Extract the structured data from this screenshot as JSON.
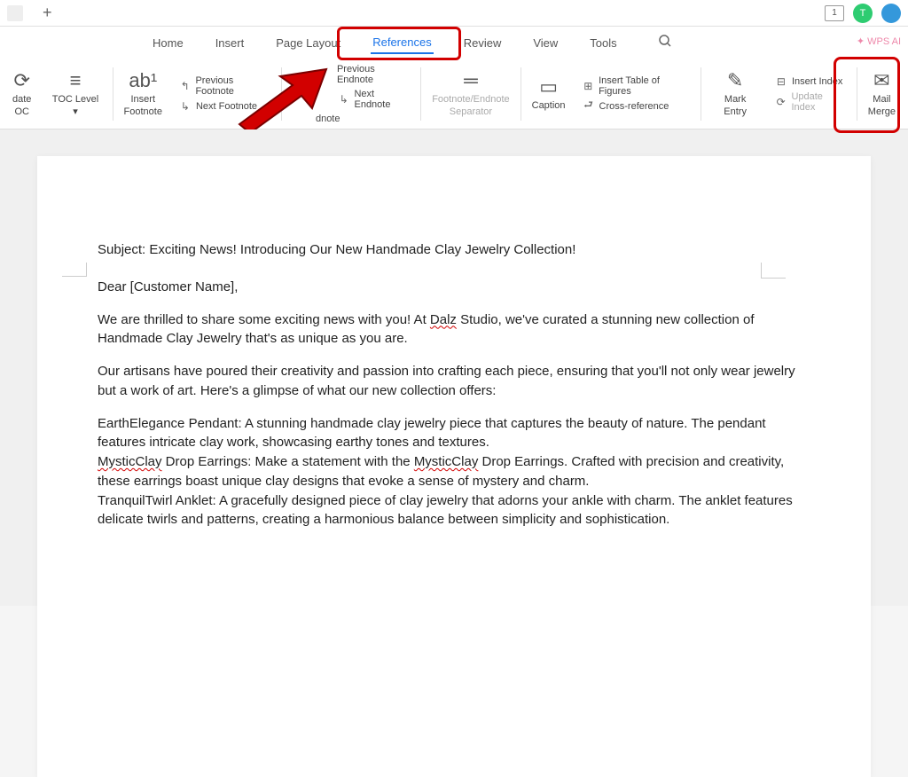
{
  "titlebar": {
    "plus": "+",
    "badge": "1",
    "user": "T"
  },
  "menu": {
    "home": "Home",
    "insert": "Insert",
    "page_layout": "Page Layout",
    "references": "References",
    "review": "Review",
    "view": "View",
    "tools": "Tools"
  },
  "wps_ai": "✦ WPS AI",
  "ribbon": {
    "date_oc": "date\nOC",
    "toc_level": "TOC Level ▾",
    "insert_footnote": "Insert\nFootnote",
    "prev_footnote": "Previous Footnote",
    "next_footnote": "Next Footnote",
    "dnote": "dnote",
    "prev_endnote": "Previous Endnote",
    "next_endnote": "Next Endnote",
    "footnote_separator": "Footnote/Endnote\nSeparator",
    "caption": "Caption",
    "insert_tof": "Insert Table of Figures",
    "cross_ref": "Cross-reference",
    "mark_entry": "Mark Entry",
    "insert_index": "Insert Index",
    "update_index": "Update Index",
    "mail_merge": "Mail\nMerge"
  },
  "document": {
    "subject": "Subject: Exciting News! Introducing Our New Handmade Clay Jewelry Collection!",
    "greeting": "Dear [Customer Name],",
    "para1_a": "We are thrilled to share some exciting news with you! At ",
    "para1_dalz": "Dalz",
    "para1_b": " Studio, we've curated a stunning new collection of Handmade Clay Jewelry that's as unique as you are.",
    "para2": "Our artisans have poured their creativity and passion into crafting each piece, ensuring that you'll not only wear jewelry but a work of art. Here's a glimpse of what our new collection offers:",
    "para3_a": "EarthElegance Pendant: A stunning handmade clay jewelry piece that captures the beauty of nature. The pendant features intricate clay work, showcasing earthy tones and textures.",
    "para3_mystic1": "MysticClay",
    "para3_b": " Drop Earrings: Make a statement with the ",
    "para3_mystic2": "MysticClay",
    "para3_c": " Drop Earrings. Crafted with precision and creativity, these earrings boast unique clay designs that evoke a sense of mystery and charm.",
    "para3_d": "TranquilTwirl Anklet: A gracefully designed piece of clay jewelry that adorns your ankle with charm. The anklet features delicate twirls and patterns, creating a harmonious balance between simplicity and sophistication."
  }
}
